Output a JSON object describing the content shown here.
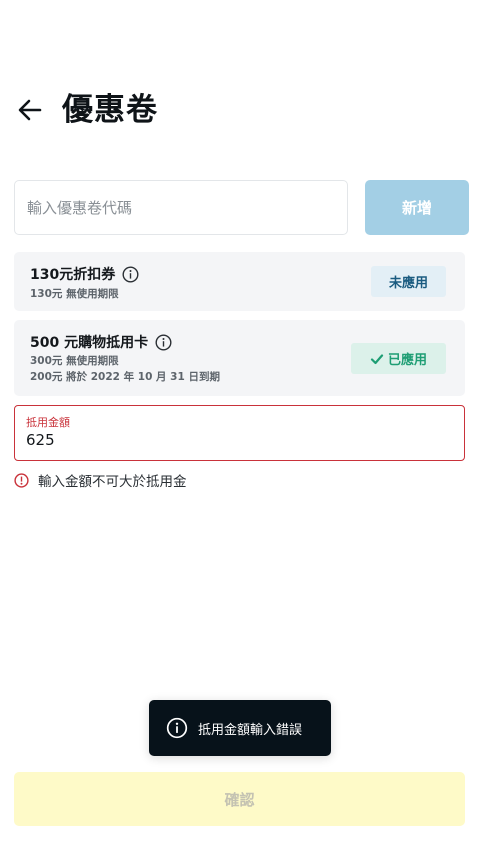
{
  "header": {
    "back_icon": "arrow-left-icon",
    "title": "優惠卷"
  },
  "code_entry": {
    "placeholder": "輸入優惠卷代碼",
    "value": "",
    "add_label": "新增"
  },
  "coupons": [
    {
      "title": "130元折扣券",
      "lines": [
        "130元 無使用期限"
      ],
      "status_label": "未應用",
      "applied": false
    },
    {
      "title": "500 元購物抵用卡",
      "lines": [
        "300元 無使用期限",
        "200元 將於 2022 年 10 月 31 日到期"
      ],
      "status_label": "已應用",
      "applied": true
    }
  ],
  "amount": {
    "label": "抵用金額",
    "value": "625",
    "error": "輸入金額不可大於抵用金"
  },
  "toast": {
    "icon": "info-icon",
    "text": "抵用金額輸入錯誤"
  },
  "confirm_label": "確認",
  "colors": {
    "error": "#c9323a",
    "add_button": "#a3cfe5",
    "applied": "#1e9e74",
    "unapplied": "#1a5b80",
    "confirm_disabled": "#fefac8",
    "toast_bg": "#07121a"
  }
}
